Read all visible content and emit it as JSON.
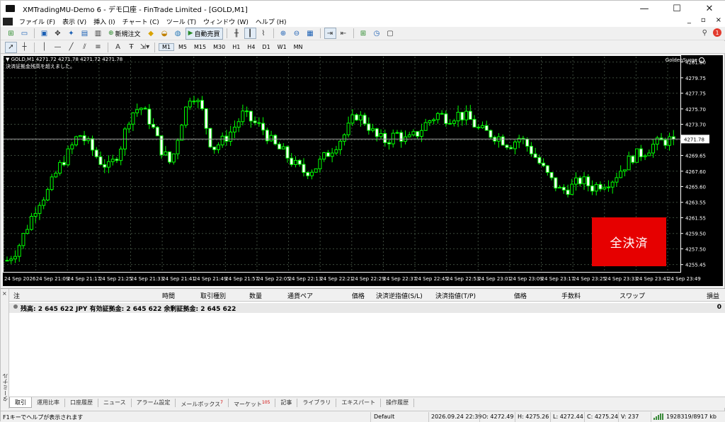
{
  "window": {
    "title": "XMTradingMU-Demo 6 - デモ口座 - FinTrade Limited - [GOLD,M1]",
    "min_glyph": "—",
    "max_glyph": "☐",
    "close_glyph": "✕"
  },
  "menu": [
    "ファイル (F)",
    "表示 (V)",
    "挿入 (I)",
    "チャート (C)",
    "ツール (T)",
    "ウィンドウ (W)",
    "ヘルプ (H)"
  ],
  "mdi_controls": {
    "min": "_",
    "restore": "▫",
    "close": "×"
  },
  "toolbar": {
    "new_order": "新規注文",
    "auto_trading": "自動売買",
    "timeframes": [
      "M1",
      "M5",
      "M15",
      "M30",
      "H1",
      "H4",
      "D1",
      "W1",
      "MN"
    ],
    "notification_count": "1"
  },
  "chart": {
    "caption": "▼ GOLD,M1  4271.72 4271.78 4271.72 4271.78",
    "message": "決済証拠金残高を超えました。",
    "ea_name": "GoldenSurge",
    "close_all_label": "全決済",
    "current_price_label": "4271.78",
    "colors": {
      "bg": "#000000",
      "candle": "#00ff00",
      "grid": "#3c4a3c",
      "button": "#e60000"
    }
  },
  "chart_data": {
    "type": "candlestick",
    "symbol": "GOLD",
    "timeframe": "M1",
    "ylim": [
      4254.5,
      4282.5
    ],
    "y_ticks": [
      4281.8,
      4279.75,
      4277.75,
      4275.7,
      4273.7,
      4271.65,
      4269.65,
      4267.6,
      4265.6,
      4263.55,
      4261.55,
      4259.5,
      4257.5,
      4255.45
    ],
    "x_ticks": [
      "24 Sep 2026",
      "24 Sep 21:09",
      "24 Sep 21:17",
      "24 Sep 21:25",
      "24 Sep 21:33",
      "24 Sep 21:41",
      "24 Sep 21:49",
      "24 Sep 21:57",
      "24 Sep 22:05",
      "24 Sep 22:13",
      "24 Sep 22:21",
      "24 Sep 22:29",
      "24 Sep 22:37",
      "24 Sep 22:45",
      "24 Sep 22:53",
      "24 Sep 23:01",
      "24 Sep 23:09",
      "24 Sep 23:17",
      "24 Sep 23:25",
      "24 Sep 23:33",
      "24 Sep 23:41",
      "24 Sep 23:49"
    ],
    "close_path": [
      4256.0,
      4257.5,
      4260.5,
      4263.5,
      4265.0,
      4268.0,
      4270.0,
      4272.5,
      4271.0,
      4269.0,
      4268.0,
      4270.5,
      4275.0,
      4276.0,
      4274.0,
      4270.5,
      4268.5,
      4274.0,
      4278.0,
      4275.5,
      4270.5,
      4271.5,
      4273.0,
      4275.0,
      4274.0,
      4273.0,
      4271.0,
      4270.0,
      4268.5,
      4267.5,
      4268.0,
      4269.5,
      4271.0,
      4272.5,
      4275.0,
      4274.0,
      4272.0,
      4271.5,
      4272.5,
      4271.5,
      4272.5,
      4274.0,
      4275.0,
      4274.5,
      4275.0,
      4274.5,
      4273.0,
      4272.5,
      4272.0,
      4271.0,
      4272.0,
      4270.5,
      4268.5,
      4266.5,
      4265.0,
      4265.5,
      4266.5,
      4265.5,
      4266.0,
      4266.5,
      4268.0,
      4269.5,
      4270.0,
      4271.0,
      4271.5,
      4271.78
    ],
    "current_price": 4271.78
  },
  "terminal": {
    "side_label": "ターミナル",
    "close_x": "×",
    "columns": [
      "注",
      "時間",
      "取引種別",
      "数量",
      "通貨ペア",
      "価格",
      "決済逆指値(S/L)",
      "決済指値(T/P)",
      "価格",
      "手数料",
      "スワップ",
      "損益"
    ],
    "balance_text": "残高: 2 645 622 JPY  有効証拠金: 2 645 622  余剰証拠金: 2 645 622",
    "balance_profit": "0",
    "tabs": [
      {
        "label": "取引",
        "sup": ""
      },
      {
        "label": "運用比率",
        "sup": ""
      },
      {
        "label": "口座履歴",
        "sup": ""
      },
      {
        "label": "ニュース",
        "sup": ""
      },
      {
        "label": "アラーム設定",
        "sup": ""
      },
      {
        "label": "メールボックス",
        "sup": "7"
      },
      {
        "label": "マーケット",
        "sup": "105"
      },
      {
        "label": "記事",
        "sup": ""
      },
      {
        "label": "ライブラリ",
        "sup": ""
      },
      {
        "label": "エキスパート",
        "sup": ""
      },
      {
        "label": "操作履歴",
        "sup": ""
      }
    ]
  },
  "status": {
    "help": "F1キーでヘルプが表示されます",
    "profile": "Default",
    "datetime": "2026.09.24 22:39",
    "open": "O: 4272.49",
    "high": "H: 4275.26",
    "low": "L: 4272.44",
    "close": "C: 4275.24",
    "volume": "V: 237",
    "traffic": "1928319/8917 kb"
  }
}
